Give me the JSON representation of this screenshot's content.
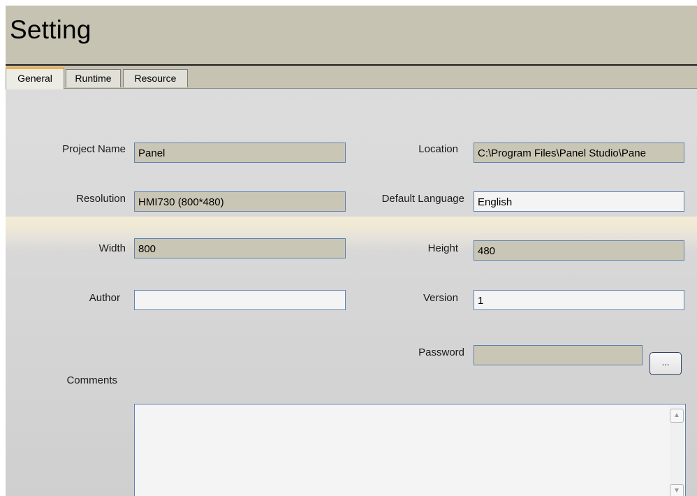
{
  "window": {
    "title": "Setting"
  },
  "tabs": [
    {
      "label": "General"
    },
    {
      "label": "Runtime"
    },
    {
      "label": "Resource"
    }
  ],
  "fields": {
    "project_name": {
      "label": "Project Name",
      "value": "Panel"
    },
    "location": {
      "label": "Location",
      "value": "C:\\Program Files\\Panel Studio\\Pane"
    },
    "resolution": {
      "label": "Resolution",
      "value": "HMI730 (800*480)"
    },
    "default_language": {
      "label": "Default Language",
      "value": "English"
    },
    "width": {
      "label": "Width",
      "value": "800"
    },
    "height": {
      "label": "Height",
      "value": "480"
    },
    "author": {
      "label": "Author",
      "value": ""
    },
    "version": {
      "label": "Version",
      "value": "1"
    },
    "password": {
      "label": "Password",
      "value": "",
      "button_label": "..."
    },
    "comments": {
      "label": "Comments",
      "value": ""
    }
  },
  "icons": {
    "scroll_up": "scroll-up-arrow",
    "scroll_down": "scroll-down-arrow"
  },
  "colors": {
    "banner": "#c6c3b3",
    "field_border": "#5d82b0",
    "active_tab_accent": "#f0b24a"
  }
}
